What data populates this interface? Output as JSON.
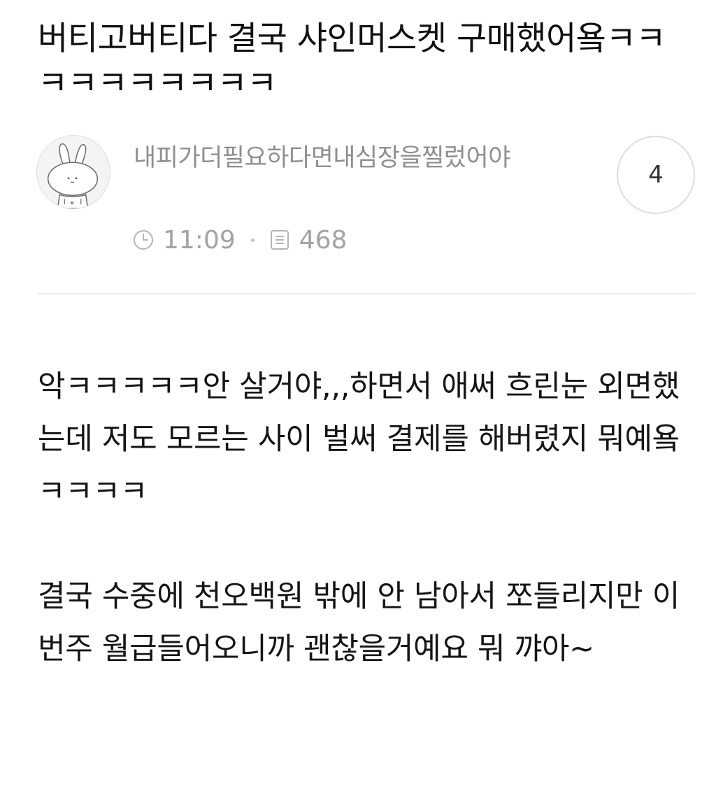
{
  "post": {
    "title": "버티고버티다 결국 샤인머스켓 구매했어욬ㅋㅋㅋㅋㅋㅋㅋㅋㅋㅋ",
    "author": {
      "name": "내피가더필요하다면내심장을찔렀어야",
      "avatar_icon": "bunny-avatar-icon"
    },
    "meta": {
      "time": "11:09",
      "time_icon": "clock-icon",
      "views": "468",
      "views_icon": "document-icon"
    },
    "comment_count": "4",
    "body": [
      "악ㅋㅋㅋㅋㅋ안 살거야,,,하면서 애써 흐린눈 외면했는데 저도 모르는 사이 벌써 결제를 해버렸지 뭐예욬ㅋㅋㅋㅋ",
      "결국 수중에 천오백원 밖에 안 남아서 쪼들리지만 이번주 월급들어오니까 괜찮을거예요 뭐 꺄아~"
    ]
  },
  "colors": {
    "title": "#111111",
    "author": "#8f8f8f",
    "meta": "#a3a3a3",
    "divider": "#ececec",
    "badge_border": "#dedede"
  }
}
